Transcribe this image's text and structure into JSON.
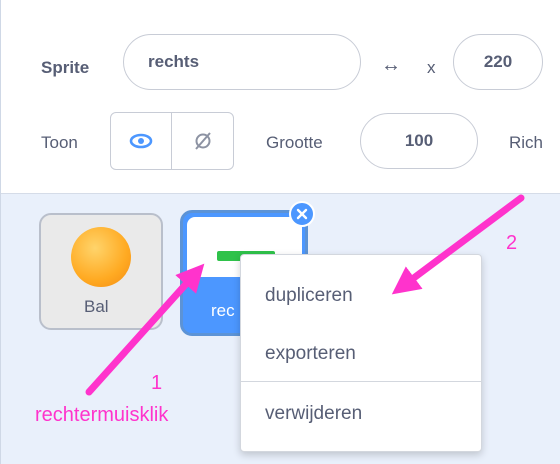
{
  "sprite_info": {
    "sprite_label": "Sprite",
    "sprite_name": "rechts",
    "x_arrow_glyph": "↔",
    "x_label": "x",
    "x_value": "220",
    "show_label": "Toon",
    "size_label": "Grootte",
    "size_value": "100",
    "direction_label_partial": "Rich",
    "show_toggle_icons": [
      "eye-icon",
      "hidden-eye-icon"
    ]
  },
  "sprites": [
    {
      "name": "Bal",
      "icon": "ball-icon",
      "selected": false
    },
    {
      "name_visible_partial": "rec",
      "icon": "paddle-icon",
      "selected": true
    }
  ],
  "context_menu": {
    "items": [
      "dupliceren",
      "exporteren",
      "verwijderen"
    ]
  },
  "annotations": {
    "step_1": "1",
    "step_1_text": "rechtermuisklik",
    "step_2": "2",
    "color": "#ff33cc"
  },
  "colors": {
    "accent": "#4c97ff",
    "text": "#575e75",
    "panel_bg": "#e9f0fb"
  }
}
